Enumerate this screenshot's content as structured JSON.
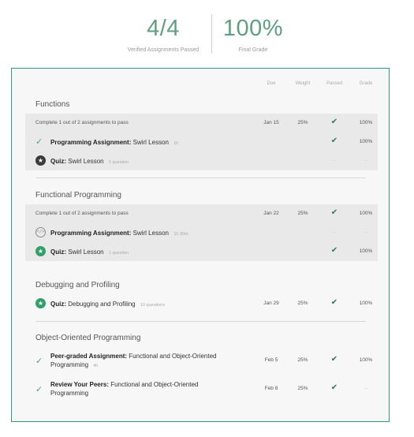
{
  "summary": {
    "assignments_value": "4/4",
    "assignments_label": "Verified Assignments Passed",
    "grade_value": "100%",
    "grade_label": "Final Grade"
  },
  "columns": {
    "due": "Due",
    "weight": "Weight",
    "passed": "Passed",
    "grade": "Grade"
  },
  "colors": {
    "accent": "#2d9a74",
    "check": "#2a7a52",
    "star_green": "#2fa06a"
  },
  "sections": [
    {
      "title": "Functions",
      "requirement": {
        "text": "Complete 1 out of 2 assignments to pass",
        "due": "Jan 15",
        "weight": "25%",
        "passed": "check-icon",
        "grade": "100%"
      },
      "items": [
        {
          "icon": "check-icon",
          "type": "Programming Assignment:",
          "name": "Swirl Lesson",
          "meta": "1h",
          "passed": "check-icon",
          "grade": "100%"
        },
        {
          "icon": "star-icon",
          "type": "Quiz:",
          "name": "Swirl Lesson",
          "meta": "1 question",
          "passed": "--",
          "grade": "--"
        }
      ]
    },
    {
      "title": "Functional Programming",
      "requirement": {
        "text": "Complete 1 out of 2 assignments to pass",
        "due": "Jan 22",
        "weight": "25%",
        "passed": "check-icon",
        "grade": "100%"
      },
      "items": [
        {
          "icon": "code-icon",
          "type": "Programming Assignment:",
          "name": "Swirl Lesson",
          "meta": "1h 30m",
          "passed": "--",
          "grade": "--"
        },
        {
          "icon": "star-green-icon",
          "type": "Quiz:",
          "name": "Swirl Lesson",
          "meta": "1 question",
          "passed": "check-icon",
          "grade": "100%"
        }
      ]
    },
    {
      "title": "Debugging and Profiling",
      "items": [
        {
          "icon": "star-green-icon",
          "type": "Quiz:",
          "name": "Debugging and Profiling",
          "meta": "10 questions",
          "due": "Jan 29",
          "weight": "25%",
          "passed": "check-icon",
          "grade": "100%"
        }
      ]
    },
    {
      "title": "Object-Oriented Programming",
      "items": [
        {
          "icon": "check-icon",
          "type": "Peer-graded Assignment:",
          "name": "Functional and Object-Oriented",
          "name_line2": "Programming",
          "meta": "4h",
          "due": "Feb 5",
          "weight": "25%",
          "passed": "check-icon",
          "grade": "100%"
        },
        {
          "icon": "check-icon",
          "type": "Review Your Peers:",
          "name": "Functional and Object-Oriented",
          "name_line2": "Programming",
          "meta": "",
          "due": "Feb 8",
          "weight": "25%",
          "passed": "check-icon",
          "grade": "--"
        }
      ]
    }
  ]
}
